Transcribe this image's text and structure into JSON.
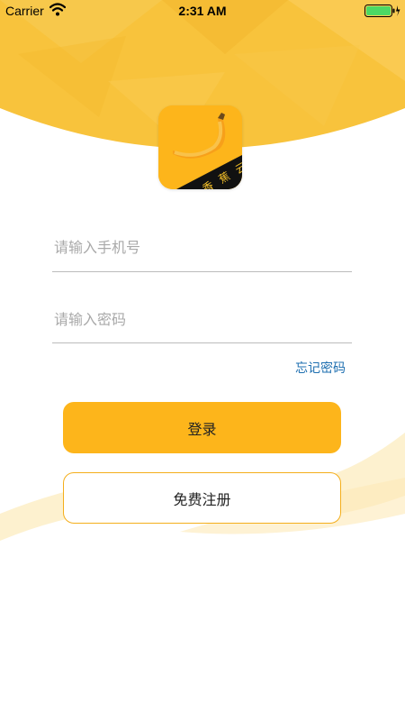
{
  "status_bar": {
    "carrier": "Carrier",
    "time": "2:31 AM",
    "battery_color": "#4cd964"
  },
  "theme": {
    "brand_yellow": "#fdb51b",
    "link_blue": "#1e6fb0"
  },
  "logo": {
    "label": "香蕉云",
    "icon": "banana-icon"
  },
  "form": {
    "phone_placeholder": "请输入手机号",
    "phone_value": "",
    "password_placeholder": "请输入密码",
    "password_value": "",
    "forgot_label": "忘记密码"
  },
  "buttons": {
    "login_label": "登录",
    "register_label": "免费注册"
  }
}
